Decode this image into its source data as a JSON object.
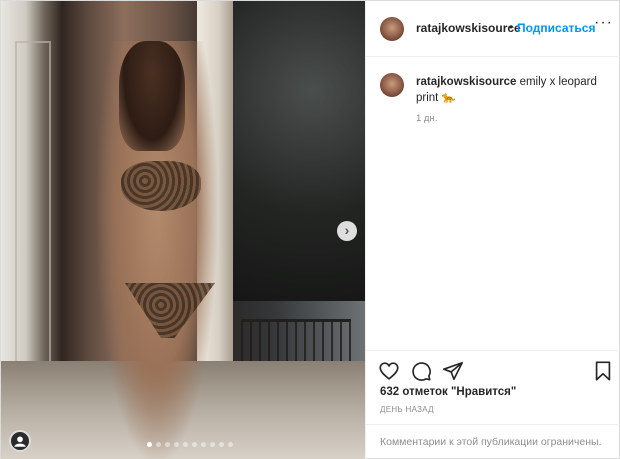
{
  "header": {
    "username": "ratajkowskisource",
    "separator": "•",
    "follow_label": "Подписаться",
    "more_icon": "more-horizontal-icon",
    "more_symbol": "···"
  },
  "caption": {
    "username": "ratajkowskisource",
    "text": "emily x leopard print",
    "emoji": "🐆",
    "time": "1 дн."
  },
  "media": {
    "next_icon": "chevron-right-icon",
    "next_symbol": "›",
    "carousel": {
      "total": 10,
      "active": 0
    },
    "corner_icon": "account-badge-icon"
  },
  "actions": {
    "like_icon": "heart-icon",
    "comment_icon": "comment-icon",
    "share_icon": "share-icon",
    "save_icon": "bookmark-icon"
  },
  "likes": "632 отметок \"Нравится\"",
  "date": "ДЕНЬ НАЗАД",
  "comments": {
    "text": "Комментарии к этой публикации ограничены."
  },
  "colors": {
    "accent": "#0095f6",
    "text": "#262626",
    "muted": "#8e8e8e",
    "border": "#efefef"
  }
}
